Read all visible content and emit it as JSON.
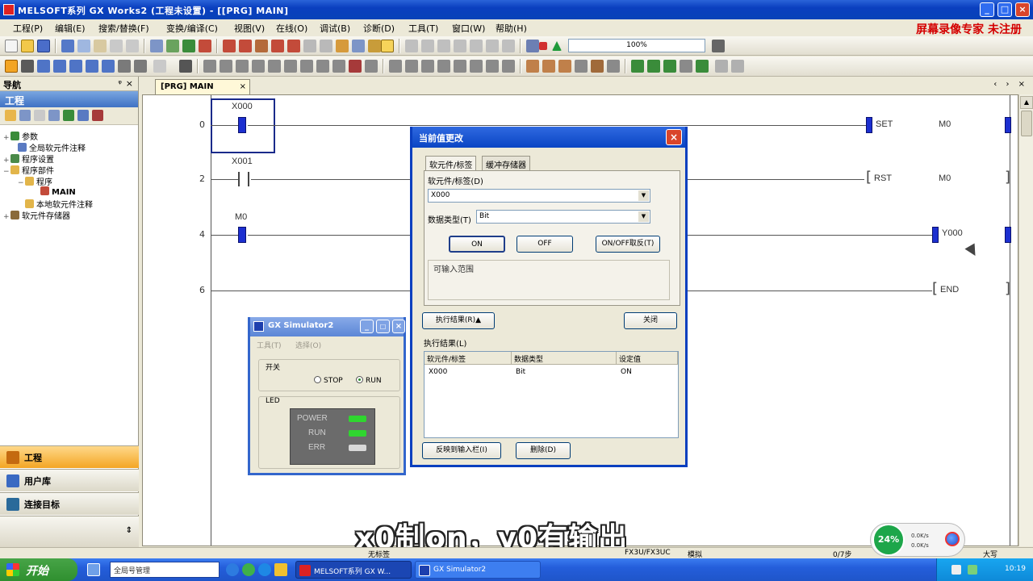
{
  "window": {
    "title": "MELSOFT系列 GX Works2 (工程未设置) - [[PRG] MAIN]",
    "watermark": "屏幕录像专家 未注册"
  },
  "menu": [
    "工程(P)",
    "编辑(E)",
    "搜索/替换(F)",
    "变换/编译(C)",
    "视图(V)",
    "在线(O)",
    "调试(B)",
    "诊断(D)",
    "工具(T)",
    "窗口(W)",
    "帮助(H)"
  ],
  "toolbar": {
    "zoom": "100%"
  },
  "nav": {
    "header": "导航",
    "pin": "ᵠ",
    "close": "×",
    "section": "工程",
    "tree": [
      {
        "label": "参数",
        "exp": "+"
      },
      {
        "label": "全局软元件注释",
        "exp": ""
      },
      {
        "label": "程序设置",
        "exp": "+"
      },
      {
        "label": "程序部件",
        "exp": "−"
      },
      {
        "label": "程序",
        "exp": "−"
      },
      {
        "label": "MAIN",
        "exp": ""
      },
      {
        "label": "本地软元件注释",
        "exp": ""
      },
      {
        "label": "软元件存储器",
        "exp": "+"
      }
    ],
    "bottom_buttons": [
      "工程",
      "用户库",
      "连接目标"
    ]
  },
  "editor": {
    "tab": "[PRG] MAIN",
    "tab_close": "×",
    "tab_nav": "‹ › ×",
    "rungs": [
      {
        "step": "0",
        "contact": "X000",
        "instr": "SET",
        "operand": "M0"
      },
      {
        "step": "2",
        "contact": "X001",
        "instr": "RST",
        "operand": "M0"
      },
      {
        "step": "4",
        "contact": "M0",
        "operand": "Y000"
      },
      {
        "step": "6",
        "instr": "END"
      }
    ]
  },
  "device_dialog": {
    "title": "当前值更改",
    "close": "×",
    "tabs": [
      "软元件/标签",
      "缓冲存储器"
    ],
    "device_label": "软元件/标签(D)",
    "device_value": "X000",
    "datatype_label": "数据类型(T)",
    "datatype_value": "Bit",
    "btn_on": "ON",
    "btn_off": "OFF",
    "btn_toggle": "ON/OFF取反(T)",
    "input_note": "可输入范围",
    "btn_exec_result": "执行结果(R)▲",
    "btn_close": "关闭",
    "result_label": "执行结果(L)",
    "result_cols": [
      "软元件/标签",
      "数据类型",
      "设定值"
    ],
    "result_rows": [
      [
        "X000",
        "Bit",
        "ON"
      ]
    ],
    "btn_reflect": "反映到输入栏(I)",
    "btn_delete": "删除(D)"
  },
  "simulator": {
    "title": "GX Simulator2",
    "menu": [
      "工具(T)",
      "选择(O)"
    ],
    "switch_label": "开关",
    "stop": "STOP",
    "run": "RUN",
    "led_label": "LED",
    "leds": [
      {
        "name": "POWER",
        "color": "#2fd62f"
      },
      {
        "name": "RUN",
        "color": "#2fd62f"
      },
      {
        "name": "ERR",
        "color": "#d8d8d8"
      }
    ]
  },
  "subtitle": "x0制on，y0有输出",
  "statusbar": {
    "left": "无标签",
    "cpu": "FX3U/FX3UC",
    "mode": "模拟",
    "steps": "0/7步",
    "ime": "大写"
  },
  "network": {
    "percent": "24%",
    "up": "0.0K/s",
    "down": "0.0K/s"
  },
  "taskbar": {
    "start": "开始",
    "address": "全局号管理",
    "tasks": [
      "MELSOFT系列 GX W...",
      "GX Simulator2"
    ],
    "time": "10:19"
  },
  "colors": {
    "contact_on": "#1c2fd0",
    "titlebar": "#0a3fbf",
    "start": "#2f8f2f",
    "watermark": "#d40000"
  }
}
